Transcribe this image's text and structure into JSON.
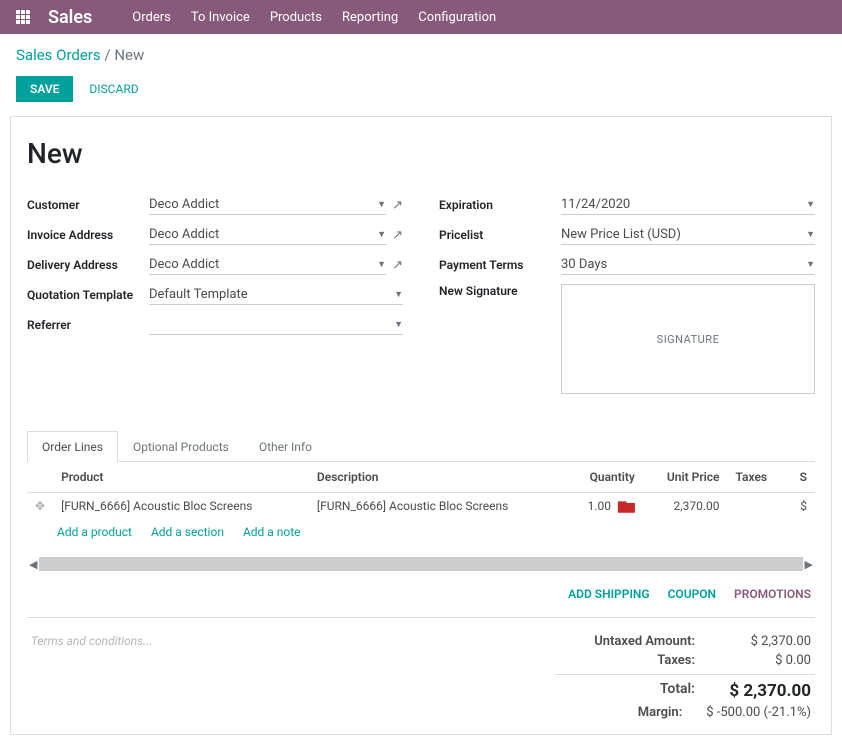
{
  "navbar": {
    "brand": "Sales",
    "menu": [
      "Orders",
      "To Invoice",
      "Products",
      "Reporting",
      "Configuration"
    ]
  },
  "breadcrumb": {
    "root": "Sales Orders",
    "sep": "/",
    "leaf": "New"
  },
  "actions": {
    "save": "SAVE",
    "discard": "DISCARD"
  },
  "title": "New",
  "left_fields": {
    "customer": {
      "label": "Customer",
      "value": "Deco Addict"
    },
    "invoice_address": {
      "label": "Invoice Address",
      "value": "Deco Addict"
    },
    "delivery_address": {
      "label": "Delivery Address",
      "value": "Deco Addict"
    },
    "quotation_template": {
      "label": "Quotation Template",
      "value": "Default Template"
    },
    "referrer": {
      "label": "Referrer",
      "value": ""
    }
  },
  "right_fields": {
    "expiration": {
      "label": "Expiration",
      "value": "11/24/2020"
    },
    "pricelist": {
      "label": "Pricelist",
      "value": "New Price List (USD)"
    },
    "payment_terms": {
      "label": "Payment Terms",
      "value": "30 Days"
    },
    "new_signature": {
      "label": "New Signature",
      "placeholder": "SIGNATURE"
    }
  },
  "tabs": [
    "Order Lines",
    "Optional Products",
    "Other Info"
  ],
  "grid": {
    "headers": {
      "product": "Product",
      "description": "Description",
      "quantity": "Quantity",
      "unit_price": "Unit Price",
      "taxes": "Taxes",
      "subtotal": "S"
    },
    "rows": [
      {
        "product": "[FURN_6666] Acoustic Bloc Screens",
        "description": "[FURN_6666] Acoustic Bloc Screens",
        "quantity": "1.00",
        "unit_price": "2,370.00",
        "taxes": "",
        "subtotal": "$"
      }
    ],
    "add": {
      "product": "Add a product",
      "section": "Add a section",
      "note": "Add a note"
    }
  },
  "footer_links": {
    "shipping": "ADD SHIPPING",
    "coupon": "COUPON",
    "promotions": "PROMOTIONS"
  },
  "terms_placeholder": "Terms and conditions...",
  "totals": {
    "untaxed": {
      "label": "Untaxed Amount:",
      "value": "$ 2,370.00"
    },
    "taxes": {
      "label": "Taxes:",
      "value": "$ 0.00"
    },
    "total": {
      "label": "Total:",
      "value": "$ 2,370.00"
    },
    "margin": {
      "label": "Margin:",
      "value": "$ -500.00 (-21.1%)"
    }
  }
}
